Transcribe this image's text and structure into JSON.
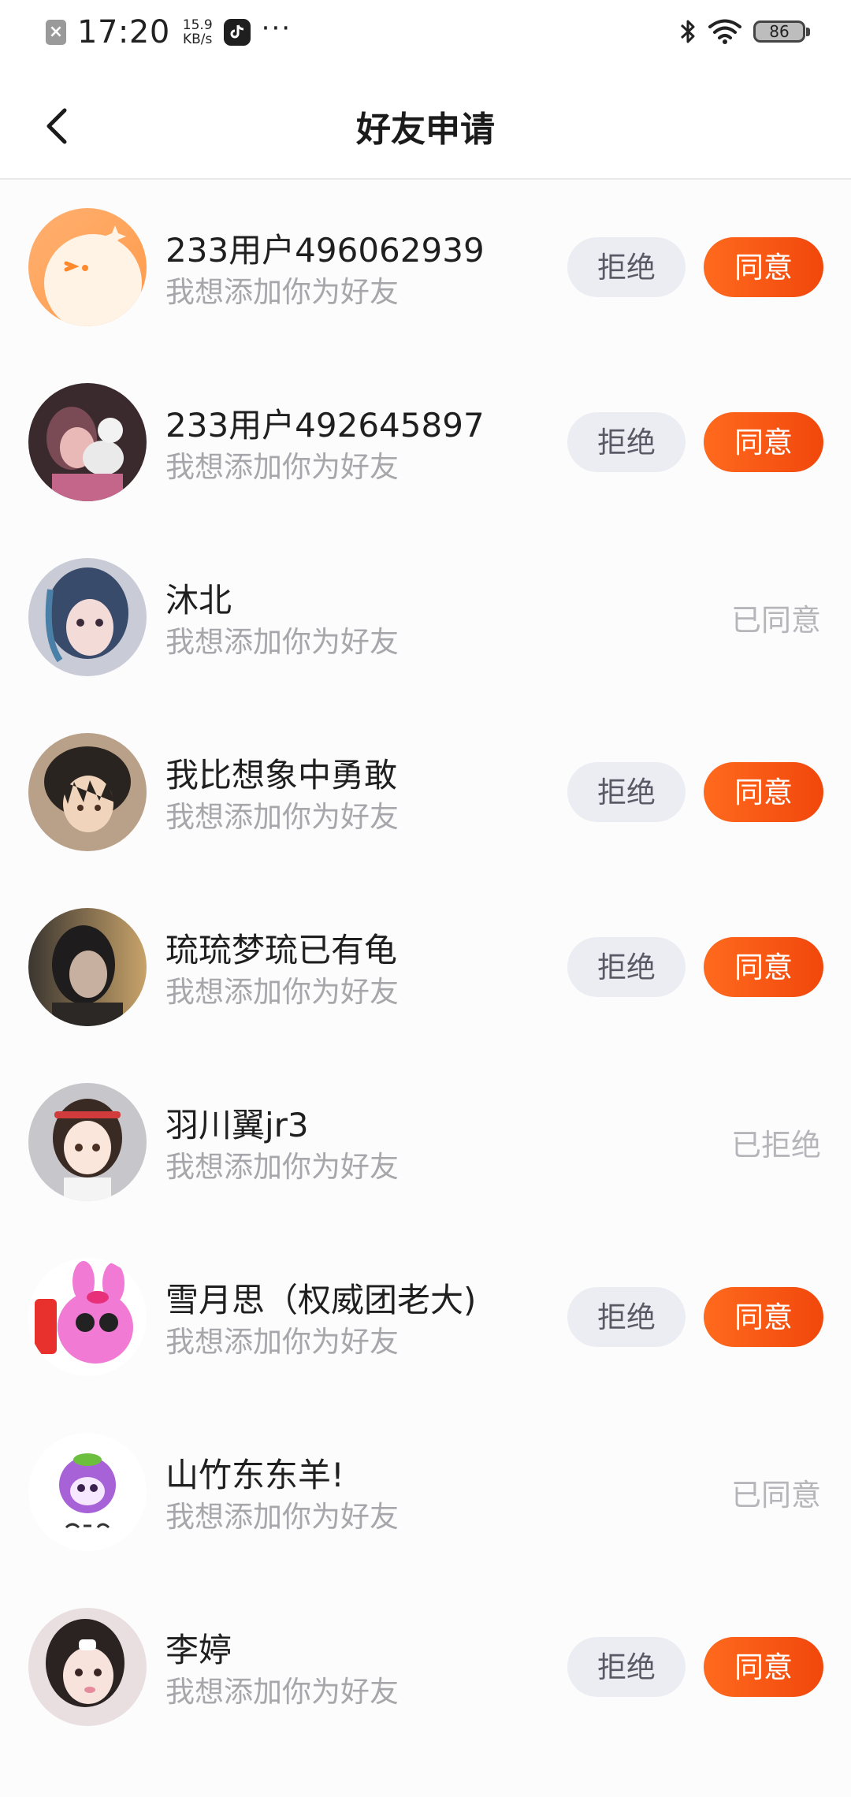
{
  "status_bar": {
    "time": "17:20",
    "speed_value": "15.9",
    "speed_unit": "KB/s",
    "dots": "···",
    "battery": "86"
  },
  "nav": {
    "title": "好友申请"
  },
  "requests": [
    {
      "name": "233用户496062939",
      "message": "我想添加你为好友",
      "reject_label": "拒绝",
      "accept_label": "同意"
    },
    {
      "name": "233用户492645897",
      "message": "我想添加你为好友",
      "reject_label": "拒绝",
      "accept_label": "同意"
    },
    {
      "name": "沐北",
      "message": "我想添加你为好友",
      "status": "已同意"
    },
    {
      "name": "我比想象中勇敢",
      "message": "我想添加你为好友",
      "reject_label": "拒绝",
      "accept_label": "同意"
    },
    {
      "name": "琉琉梦琉已有龟",
      "message": "我想添加你为好友",
      "reject_label": "拒绝",
      "accept_label": "同意"
    },
    {
      "name": "羽川翼jr3",
      "message": "我想添加你为好友",
      "status": "已拒绝"
    },
    {
      "name": "雪月思（权威团老大)",
      "message": "我想添加你为好友",
      "reject_label": "拒绝",
      "accept_label": "同意"
    },
    {
      "name": "山竹东东羊!",
      "message": "我想添加你为好友",
      "status": "已同意"
    },
    {
      "name": "李婷",
      "message": "我想添加你为好友",
      "reject_label": "拒绝",
      "accept_label": "同意"
    }
  ]
}
